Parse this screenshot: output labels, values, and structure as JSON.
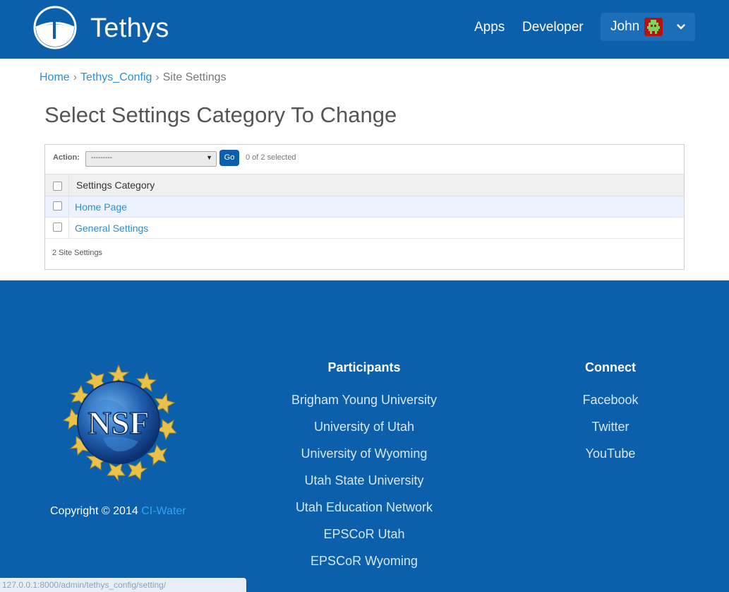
{
  "header": {
    "brand": "Tethys",
    "nav": {
      "apps": "Apps",
      "developer": "Developer"
    },
    "user": {
      "name": "John"
    }
  },
  "breadcrumb": {
    "home": "Home",
    "config": "Tethys_Config",
    "current": "Site Settings",
    "separator": "›"
  },
  "page": {
    "title": "Select Settings Category To Change"
  },
  "changelist": {
    "action_label": "Action:",
    "action_value": "---------",
    "go_label": "Go",
    "selected_count": "0 of 2 selected",
    "column_header": "Settings Category",
    "rows": [
      {
        "label": "Home Page"
      },
      {
        "label": "General Settings"
      }
    ],
    "paginator": "2 Site Settings"
  },
  "footer": {
    "logo_text": "NSF",
    "copyright_prefix": "Copyright © 2014",
    "copyright_link": "CI-Water",
    "participants_title": "Participants",
    "participants": [
      "Brigham Young University",
      "University of Utah",
      "University of Wyoming",
      "Utah State University",
      "Utah Education Network",
      "EPSCoR Utah",
      "EPSCoR Wyoming"
    ],
    "connect_title": "Connect",
    "connect": [
      "Facebook",
      "Twitter",
      "YouTube"
    ]
  },
  "status_bar": {
    "url": "127.0.0.1:8000/admin/tethys_config/setting/"
  },
  "colors": {
    "brand_blue": "#0b5fab",
    "link_blue": "#2a8fd4",
    "selected_row": "#edf3fe"
  }
}
